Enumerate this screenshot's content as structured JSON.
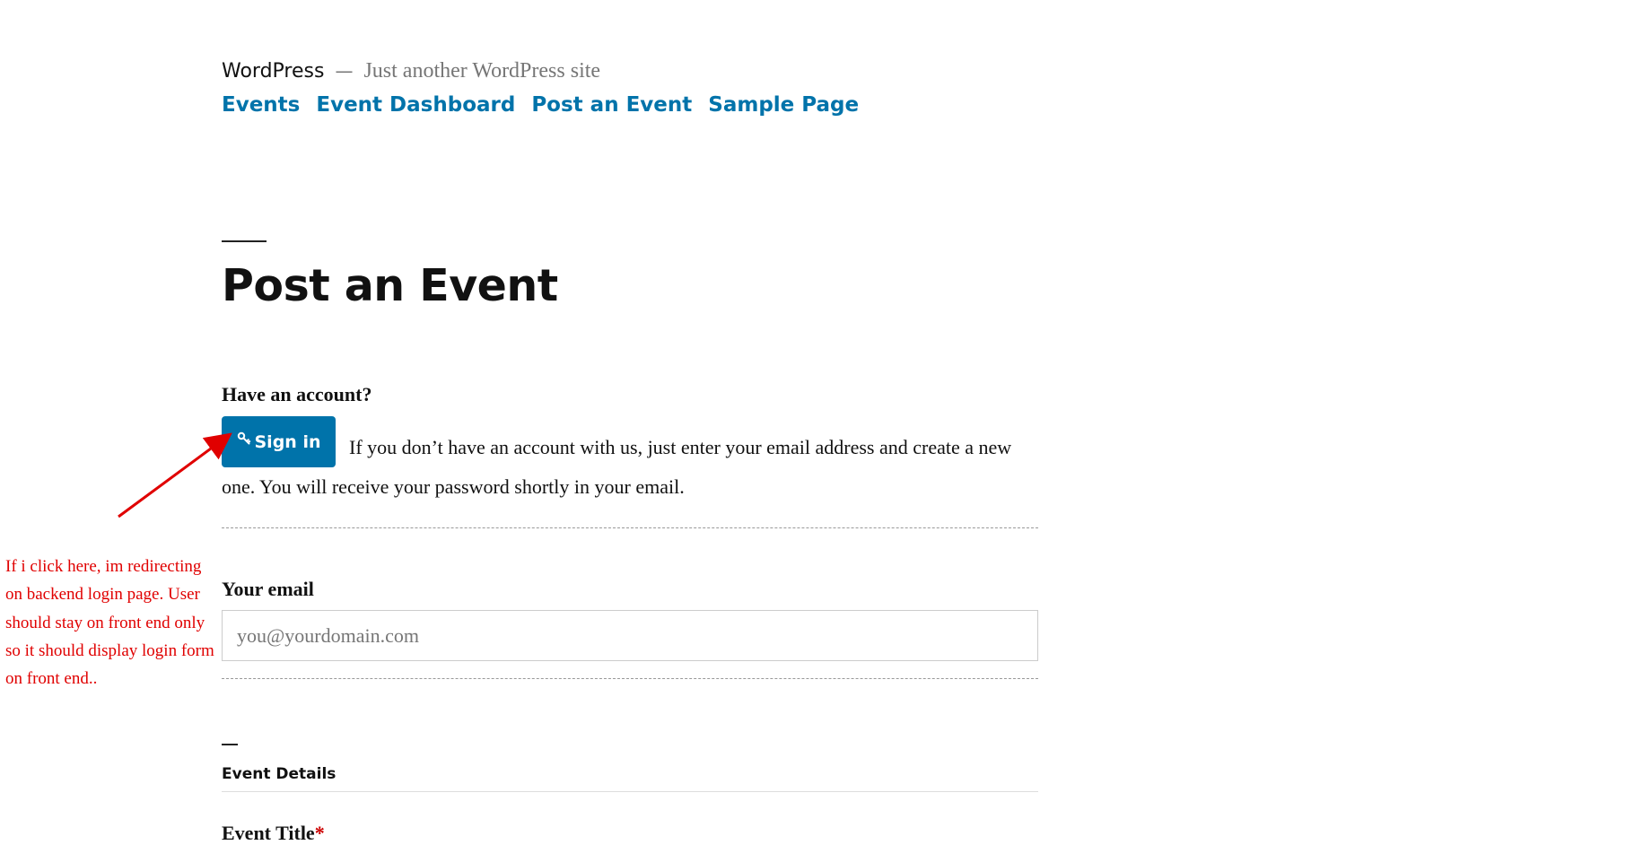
{
  "site": {
    "title": "WordPress",
    "separator": "—",
    "description": "Just another WordPress site"
  },
  "nav": {
    "items": [
      {
        "label": "Events"
      },
      {
        "label": "Event Dashboard"
      },
      {
        "label": "Post an Event"
      },
      {
        "label": "Sample Page"
      }
    ],
    "link_color": "#0073aa"
  },
  "page": {
    "title": "Post an Event"
  },
  "account": {
    "heading": "Have an account?",
    "signin_label": "Sign in",
    "signin_icon": "key-icon",
    "text_line_1": "If you don’t have an account with us, just enter your email address and create a new",
    "text_line_2": "one. You will receive your password shortly in your email.",
    "button_color": "#0073aa"
  },
  "email": {
    "label": "Your email",
    "placeholder": "you@yourdomain.com",
    "value": ""
  },
  "event_details": {
    "section_title": "Event Details",
    "title_label": "Event Title",
    "required_mark": "*"
  },
  "annotation": {
    "lines": [
      "If i click here, im redirecting",
      "on backend login page. User",
      "should stay on front end only",
      "so it should display login form",
      "on front end.."
    ],
    "color": "#e00000"
  }
}
